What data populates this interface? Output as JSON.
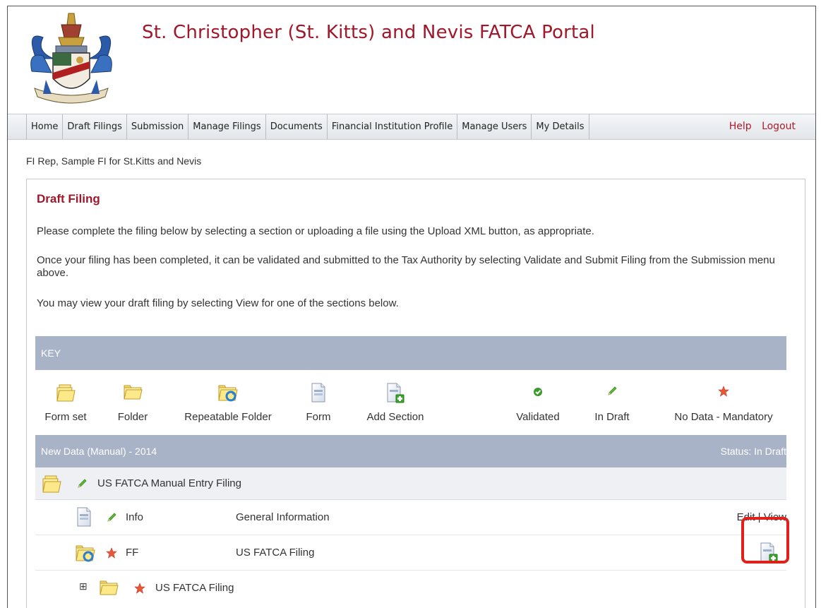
{
  "header": {
    "title": "St. Christopher (St. Kitts) and Nevis FATCA Portal"
  },
  "nav": {
    "items": [
      "Home",
      "Draft Filings",
      "Submission",
      "Manage Filings",
      "Documents",
      "Financial Institution Profile",
      "Manage Users",
      "My Details"
    ],
    "help": "Help",
    "logout": "Logout"
  },
  "user_line": "FI Rep, Sample FI for St.Kitts and Nevis",
  "panel": {
    "title": "Draft Filing",
    "para1": "Please complete the filing below by selecting a section or uploading a file using the Upload XML button, as appropriate.",
    "para2": "Once your filing has been completed, it can be validated and submitted to the Tax Authority by selecting Validate and Submit Filing from the Submission menu above.",
    "para3": "You may view your draft filing by selecting View for one of the sections below."
  },
  "key": {
    "title": "KEY",
    "items": [
      {
        "label": "Form set",
        "icon": "form-set-icon"
      },
      {
        "label": "Folder",
        "icon": "folder-icon"
      },
      {
        "label": "Repeatable Folder",
        "icon": "repeatable-folder-icon"
      },
      {
        "label": "Form",
        "icon": "form-icon"
      },
      {
        "label": "Add Section",
        "icon": "add-section-icon"
      },
      {
        "label": "Validated",
        "icon": "validated-check-icon"
      },
      {
        "label": "In Draft",
        "icon": "in-draft-pencil-icon"
      },
      {
        "label": "No Data - Mandatory",
        "icon": "mandatory-star-icon"
      }
    ]
  },
  "filing": {
    "title": "New Data (Manual) - 2014",
    "status": "Status: In Draft",
    "root": {
      "label": "US FATCA Manual Entry Filing"
    },
    "rows": [
      {
        "code": "Info",
        "name": "General Information",
        "edit": "Edit",
        "sep": " | ",
        "view": "View"
      },
      {
        "code": "FF",
        "name": "US FATCA Filing"
      }
    ],
    "sub": {
      "label": "US FATCA Filing",
      "expander": "⊞"
    }
  },
  "colors": {
    "brand": "#a0182a",
    "header_bar": "#a8b3c8",
    "highlight": "#e0201a"
  }
}
